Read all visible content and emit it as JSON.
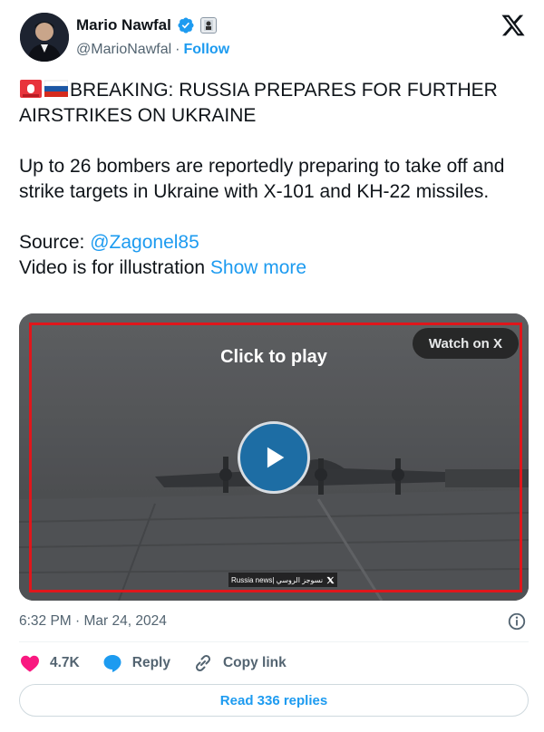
{
  "author": {
    "display_name": "Mario Nawfal",
    "handle": "@MarioNawfal",
    "separator": "·",
    "follow_label": "Follow",
    "verified_color": "#1d9bf0"
  },
  "tweet": {
    "headline_emojis": [
      "rotating-light",
      "flag-russia"
    ],
    "line1": "BREAKING: RUSSIA PREPARES FOR FURTHER AIRSTRIKES ON UKRAINE",
    "line2": "Up to 26 bombers are reportedly preparing to take off and strike targets in Ukraine with X-101 and KH-22 missiles.",
    "source_label": "Source: ",
    "source_link": "@Zagonel85",
    "line4": "Video is for illustration ",
    "show_more": "Show more"
  },
  "media": {
    "click_to_play": "Click to play",
    "watch_on_x": "Watch on X",
    "watermark": "Russia news| نسوجز الروسي",
    "frame_color": "#e0161b"
  },
  "meta": {
    "timestamp": "6:32 PM · Mar 24, 2024"
  },
  "actions": {
    "likes": "4.7K",
    "reply": "Reply",
    "copy_link": "Copy link"
  },
  "footer": {
    "read_replies": "Read 336 replies"
  },
  "colors": {
    "accent": "#1d9bf0",
    "like": "#f91880",
    "text": "#0f1419",
    "muted": "#536471"
  }
}
